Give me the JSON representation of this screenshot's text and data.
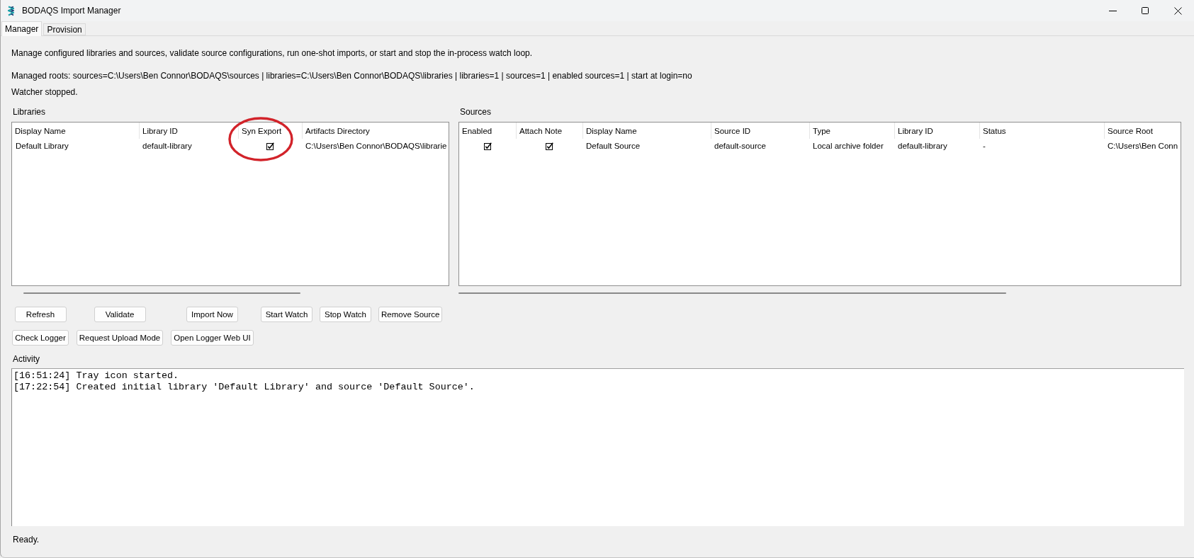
{
  "window": {
    "title": "BODAQS Import Manager"
  },
  "tabs": [
    {
      "label": "Manager",
      "selected": true
    },
    {
      "label": "Provision",
      "selected": false
    }
  ],
  "intro": {
    "description": "Manage configured libraries and sources, validate source configurations, run one-shot imports, or start and stop the in-process watch loop.",
    "managed_roots": "Managed roots: sources=C:\\Users\\Ben Connor\\BODAQS\\sources | libraries=C:\\Users\\Ben Connor\\BODAQS\\libraries | libraries=1 | sources=1 | enabled sources=1 | start at login=no",
    "watcher_status": "Watcher stopped."
  },
  "libraries": {
    "title": "Libraries",
    "columns": [
      {
        "label": "Display Name",
        "circled": false
      },
      {
        "label": "Library ID",
        "circled": false
      },
      {
        "label": "Syn Export",
        "circled": true
      },
      {
        "label": "Artifacts Directory",
        "circled": false
      }
    ],
    "rows": [
      {
        "cells": [
          {
            "kind": "text",
            "text": "Default Library"
          },
          {
            "kind": "text",
            "text": "default-library"
          },
          {
            "kind": "check",
            "checked": true
          },
          {
            "kind": "text",
            "text": "C:\\Users\\Ben Connor\\BODAQS\\librarie"
          }
        ]
      }
    ]
  },
  "sources": {
    "title": "Sources",
    "columns": [
      {
        "label": "Enabled",
        "circled": false
      },
      {
        "label": "Attach Note",
        "circled": false
      },
      {
        "label": "Display Name",
        "circled": false
      },
      {
        "label": "Source ID",
        "circled": false
      },
      {
        "label": "Type",
        "circled": false
      },
      {
        "label": "Library ID",
        "circled": false
      },
      {
        "label": "Status",
        "circled": false
      },
      {
        "label": "Source Root",
        "circled": false
      }
    ],
    "rows": [
      {
        "cells": [
          {
            "kind": "check",
            "checked": true
          },
          {
            "kind": "check",
            "checked": true
          },
          {
            "kind": "text",
            "text": "Default Source"
          },
          {
            "kind": "text",
            "text": "default-source"
          },
          {
            "kind": "text",
            "text": "Local archive folder"
          },
          {
            "kind": "text",
            "text": "default-library"
          },
          {
            "kind": "text",
            "text": "-"
          },
          {
            "kind": "text",
            "text": "C:\\Users\\Ben Conn"
          }
        ]
      }
    ]
  },
  "button_rows": [
    [
      "Refresh",
      "Validate",
      "Import Now",
      "Start Watch",
      "Stop Watch",
      "Remove Source"
    ],
    [
      "Check Logger",
      "Request Upload Mode",
      "Open Logger Web UI"
    ]
  ],
  "activity": {
    "title": "Activity",
    "lines": [
      "[16:51:24] Tray icon started.",
      "[17:22:54] Created initial library 'Default Library' and source 'Default Source'."
    ]
  },
  "status_bar": "Ready."
}
